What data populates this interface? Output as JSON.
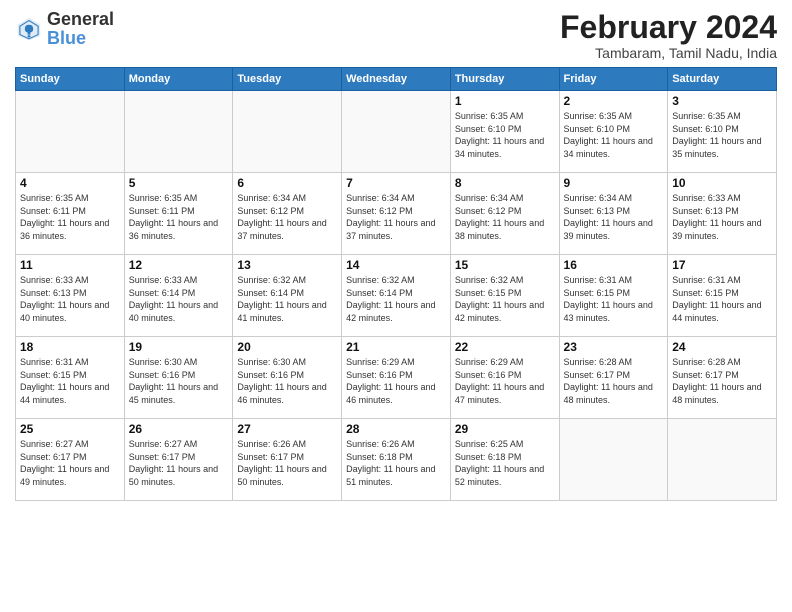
{
  "header": {
    "logo_general": "General",
    "logo_blue": "Blue",
    "title": "February 2024",
    "subtitle": "Tambaram, Tamil Nadu, India"
  },
  "weekdays": [
    "Sunday",
    "Monday",
    "Tuesday",
    "Wednesday",
    "Thursday",
    "Friday",
    "Saturday"
  ],
  "weeks": [
    [
      {
        "day": "",
        "sunrise": "",
        "sunset": "",
        "daylight": "",
        "empty": true
      },
      {
        "day": "",
        "sunrise": "",
        "sunset": "",
        "daylight": "",
        "empty": true
      },
      {
        "day": "",
        "sunrise": "",
        "sunset": "",
        "daylight": "",
        "empty": true
      },
      {
        "day": "",
        "sunrise": "",
        "sunset": "",
        "daylight": "",
        "empty": true
      },
      {
        "day": "1",
        "sunrise": "Sunrise: 6:35 AM",
        "sunset": "Sunset: 6:10 PM",
        "daylight": "Daylight: 11 hours and 34 minutes.",
        "empty": false
      },
      {
        "day": "2",
        "sunrise": "Sunrise: 6:35 AM",
        "sunset": "Sunset: 6:10 PM",
        "daylight": "Daylight: 11 hours and 34 minutes.",
        "empty": false
      },
      {
        "day": "3",
        "sunrise": "Sunrise: 6:35 AM",
        "sunset": "Sunset: 6:10 PM",
        "daylight": "Daylight: 11 hours and 35 minutes.",
        "empty": false
      }
    ],
    [
      {
        "day": "4",
        "sunrise": "Sunrise: 6:35 AM",
        "sunset": "Sunset: 6:11 PM",
        "daylight": "Daylight: 11 hours and 36 minutes.",
        "empty": false
      },
      {
        "day": "5",
        "sunrise": "Sunrise: 6:35 AM",
        "sunset": "Sunset: 6:11 PM",
        "daylight": "Daylight: 11 hours and 36 minutes.",
        "empty": false
      },
      {
        "day": "6",
        "sunrise": "Sunrise: 6:34 AM",
        "sunset": "Sunset: 6:12 PM",
        "daylight": "Daylight: 11 hours and 37 minutes.",
        "empty": false
      },
      {
        "day": "7",
        "sunrise": "Sunrise: 6:34 AM",
        "sunset": "Sunset: 6:12 PM",
        "daylight": "Daylight: 11 hours and 37 minutes.",
        "empty": false
      },
      {
        "day": "8",
        "sunrise": "Sunrise: 6:34 AM",
        "sunset": "Sunset: 6:12 PM",
        "daylight": "Daylight: 11 hours and 38 minutes.",
        "empty": false
      },
      {
        "day": "9",
        "sunrise": "Sunrise: 6:34 AM",
        "sunset": "Sunset: 6:13 PM",
        "daylight": "Daylight: 11 hours and 39 minutes.",
        "empty": false
      },
      {
        "day": "10",
        "sunrise": "Sunrise: 6:33 AM",
        "sunset": "Sunset: 6:13 PM",
        "daylight": "Daylight: 11 hours and 39 minutes.",
        "empty": false
      }
    ],
    [
      {
        "day": "11",
        "sunrise": "Sunrise: 6:33 AM",
        "sunset": "Sunset: 6:13 PM",
        "daylight": "Daylight: 11 hours and 40 minutes.",
        "empty": false
      },
      {
        "day": "12",
        "sunrise": "Sunrise: 6:33 AM",
        "sunset": "Sunset: 6:14 PM",
        "daylight": "Daylight: 11 hours and 40 minutes.",
        "empty": false
      },
      {
        "day": "13",
        "sunrise": "Sunrise: 6:32 AM",
        "sunset": "Sunset: 6:14 PM",
        "daylight": "Daylight: 11 hours and 41 minutes.",
        "empty": false
      },
      {
        "day": "14",
        "sunrise": "Sunrise: 6:32 AM",
        "sunset": "Sunset: 6:14 PM",
        "daylight": "Daylight: 11 hours and 42 minutes.",
        "empty": false
      },
      {
        "day": "15",
        "sunrise": "Sunrise: 6:32 AM",
        "sunset": "Sunset: 6:15 PM",
        "daylight": "Daylight: 11 hours and 42 minutes.",
        "empty": false
      },
      {
        "day": "16",
        "sunrise": "Sunrise: 6:31 AM",
        "sunset": "Sunset: 6:15 PM",
        "daylight": "Daylight: 11 hours and 43 minutes.",
        "empty": false
      },
      {
        "day": "17",
        "sunrise": "Sunrise: 6:31 AM",
        "sunset": "Sunset: 6:15 PM",
        "daylight": "Daylight: 11 hours and 44 minutes.",
        "empty": false
      }
    ],
    [
      {
        "day": "18",
        "sunrise": "Sunrise: 6:31 AM",
        "sunset": "Sunset: 6:15 PM",
        "daylight": "Daylight: 11 hours and 44 minutes.",
        "empty": false
      },
      {
        "day": "19",
        "sunrise": "Sunrise: 6:30 AM",
        "sunset": "Sunset: 6:16 PM",
        "daylight": "Daylight: 11 hours and 45 minutes.",
        "empty": false
      },
      {
        "day": "20",
        "sunrise": "Sunrise: 6:30 AM",
        "sunset": "Sunset: 6:16 PM",
        "daylight": "Daylight: 11 hours and 46 minutes.",
        "empty": false
      },
      {
        "day": "21",
        "sunrise": "Sunrise: 6:29 AM",
        "sunset": "Sunset: 6:16 PM",
        "daylight": "Daylight: 11 hours and 46 minutes.",
        "empty": false
      },
      {
        "day": "22",
        "sunrise": "Sunrise: 6:29 AM",
        "sunset": "Sunset: 6:16 PM",
        "daylight": "Daylight: 11 hours and 47 minutes.",
        "empty": false
      },
      {
        "day": "23",
        "sunrise": "Sunrise: 6:28 AM",
        "sunset": "Sunset: 6:17 PM",
        "daylight": "Daylight: 11 hours and 48 minutes.",
        "empty": false
      },
      {
        "day": "24",
        "sunrise": "Sunrise: 6:28 AM",
        "sunset": "Sunset: 6:17 PM",
        "daylight": "Daylight: 11 hours and 48 minutes.",
        "empty": false
      }
    ],
    [
      {
        "day": "25",
        "sunrise": "Sunrise: 6:27 AM",
        "sunset": "Sunset: 6:17 PM",
        "daylight": "Daylight: 11 hours and 49 minutes.",
        "empty": false
      },
      {
        "day": "26",
        "sunrise": "Sunrise: 6:27 AM",
        "sunset": "Sunset: 6:17 PM",
        "daylight": "Daylight: 11 hours and 50 minutes.",
        "empty": false
      },
      {
        "day": "27",
        "sunrise": "Sunrise: 6:26 AM",
        "sunset": "Sunset: 6:17 PM",
        "daylight": "Daylight: 11 hours and 50 minutes.",
        "empty": false
      },
      {
        "day": "28",
        "sunrise": "Sunrise: 6:26 AM",
        "sunset": "Sunset: 6:18 PM",
        "daylight": "Daylight: 11 hours and 51 minutes.",
        "empty": false
      },
      {
        "day": "29",
        "sunrise": "Sunrise: 6:25 AM",
        "sunset": "Sunset: 6:18 PM",
        "daylight": "Daylight: 11 hours and 52 minutes.",
        "empty": false
      },
      {
        "day": "",
        "sunrise": "",
        "sunset": "",
        "daylight": "",
        "empty": true
      },
      {
        "day": "",
        "sunrise": "",
        "sunset": "",
        "daylight": "",
        "empty": true
      }
    ]
  ]
}
